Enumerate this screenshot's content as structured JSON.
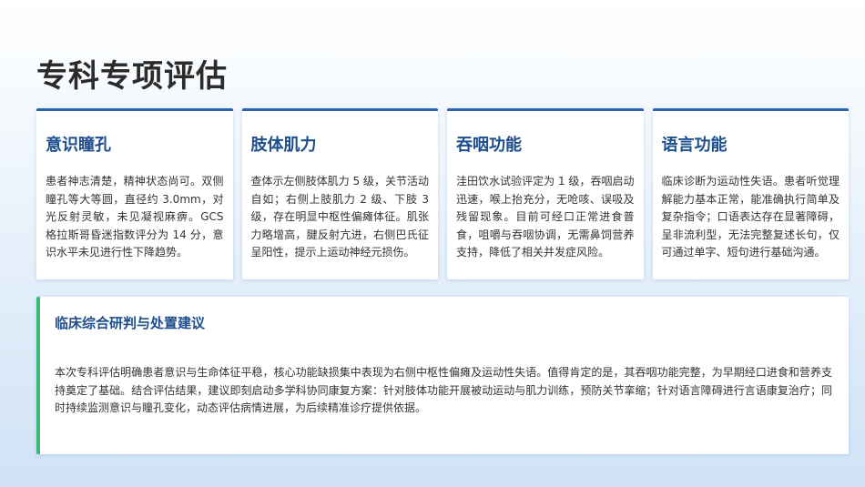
{
  "page": {
    "title": "专科专项评估"
  },
  "cards": [
    {
      "title": "意识瞳孔",
      "text": "患者神志清楚，精神状态尚可。双侧瞳孔等大等圆，直径约 3.0mm，对光反射灵敏，未见凝视麻痹。GCS 格拉斯哥昏迷指数评分为 14 分，意识水平未见进行性下降趋势。"
    },
    {
      "title": "肢体肌力",
      "text": "查体示左侧肢体肌力 5 级，关节活动自如；右侧上肢肌力 2 级、下肢 3 级，存在明显中枢性偏瘫体征。肌张力略增高，腱反射亢进，右侧巴氏征呈阳性，提示上运动神经元损伤。"
    },
    {
      "title": "吞咽功能",
      "text": "洼田饮水试验评定为 1 级，吞咽启动迅速，喉上抬充分，无呛咳、误吸及残留现象。目前可经口正常进食普食，咀嚼与吞咽协调，无需鼻饲营养支持，降低了相关并发症风险。"
    },
    {
      "title": "语言功能",
      "text": "临床诊断为运动性失语。患者听觉理解能力基本正常，能准确执行简单及复杂指令；口语表达存在显著障碍，呈非流利型，无法完整复述长句，仅可通过单字、短句进行基础沟通。"
    }
  ],
  "summary": {
    "title": "临床综合研判与处置建议",
    "text": "本次专科评估明确患者意识与生命体征平稳，核心功能缺损集中表现为右侧中枢性偏瘫及运动性失语。值得肯定的是，其吞咽功能完整，为早期经口进食和营养支持奠定了基础。结合评估结果，建议即刻启动多学科协同康复方案：针对肢体功能开展被动运动与肌力训练，预防关节挛缩；针对语言障碍进行言语康复治疗；同时持续监测意识与瞳孔变化，动态评估病情进展，为后续精准诊疗提供依据。"
  }
}
